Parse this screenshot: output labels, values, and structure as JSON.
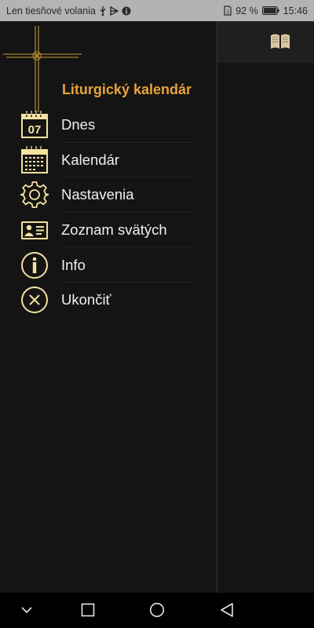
{
  "status_bar": {
    "carrier": "Len tiesňové volania",
    "battery_percent": "92 %",
    "time": "15:46",
    "icons": [
      "usb-icon",
      "network-icon",
      "info-icon",
      "sim-icon",
      "battery-icon"
    ]
  },
  "drawer": {
    "title": "Liturgický kalendár",
    "accent_color": "#e8a33a",
    "icon_color": "#f3e2a0",
    "items": [
      {
        "label": "Dnes",
        "icon": "calendar-day-icon",
        "icon_text": "07"
      },
      {
        "label": "Kalendár",
        "icon": "calendar-month-icon"
      },
      {
        "label": "Nastavenia",
        "icon": "gear-icon"
      },
      {
        "label": "Zoznam svätých",
        "icon": "id-card-icon"
      },
      {
        "label": "Info",
        "icon": "info-icon"
      },
      {
        "label": "Ukončiť",
        "icon": "close-icon"
      }
    ]
  },
  "main": {
    "toolbar_icon": "book-icon"
  },
  "nav_bar": {
    "icons": [
      "chevron-down-icon",
      "recents-icon",
      "home-icon",
      "back-icon"
    ]
  }
}
